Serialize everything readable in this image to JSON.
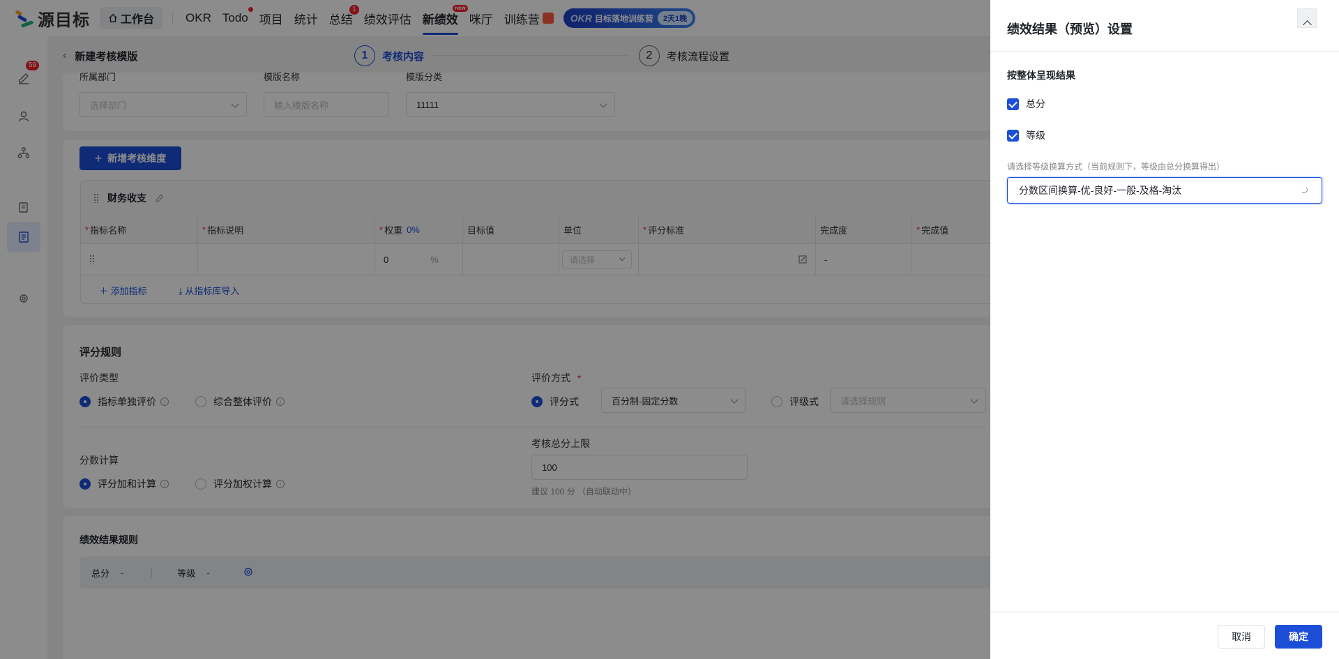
{
  "app": {
    "logo_text": "源目标"
  },
  "nav": {
    "workbench": "工作台",
    "items": [
      {
        "label": "OKR"
      },
      {
        "label": "Todo",
        "dot": true
      },
      {
        "label": "项目"
      },
      {
        "label": "统计"
      },
      {
        "label": "总结",
        "badge": "1"
      },
      {
        "label": "绩效评估"
      },
      {
        "label": "新绩效",
        "active": true,
        "badge_new": "new"
      },
      {
        "label": "咪厅"
      },
      {
        "label": "训练营"
      }
    ],
    "banner": {
      "okr": "OKR",
      "text": "目标落地训练营",
      "pill": "2天1晚"
    }
  },
  "sidebar": {
    "badge": "59"
  },
  "page": {
    "title": "新建考核模版",
    "steps": [
      {
        "num": "1",
        "label": "考核内容"
      },
      {
        "num": "2",
        "label": "考核流程设置"
      }
    ]
  },
  "basic": {
    "dept_label": "所属部门",
    "dept_placeholder": "选择部门",
    "name_label": "模版名称",
    "name_placeholder": "输入模版名称",
    "cat_label": "模版分类",
    "cat_value": "11111"
  },
  "dimension": {
    "add_button": "新增考核维度",
    "name": "财务收支",
    "columns": [
      "指标名称",
      "指标说明",
      "权重",
      "目标值",
      "单位",
      "评分标准",
      "完成度",
      "完成值"
    ],
    "weight_pct": "0%",
    "row": {
      "weight": "0",
      "unit_symbol": "%",
      "unit_placeholder": "请选择",
      "completion": "-"
    },
    "add_indicator": "添加指标",
    "import": "从指标库导入"
  },
  "scoring": {
    "title": "评分规则",
    "type_label": "评价类型",
    "type_options": [
      "指标单独评价",
      "综合整体评价"
    ],
    "method_label": "评价方式",
    "method_score": "评分式",
    "method_score_value": "百分制-固定分数",
    "method_level": "评级式",
    "method_level_placeholder": "请选择规则",
    "calc_label": "分数计算",
    "calc_options": [
      "评分加和计算",
      "评分加权计算"
    ],
    "limit_label": "考核总分上限",
    "limit_value": "100",
    "limit_hint": "建议 100 分 （自动联动中）"
  },
  "result": {
    "title": "绩效结果规则",
    "total_label": "总分",
    "total_value": "-",
    "level_label": "等级",
    "level_value": "-"
  },
  "drawer": {
    "title": "绩效结果（预览）设置",
    "section": "按整体呈现结果",
    "check_total": "总分",
    "check_level": "等级",
    "method_hint": "请选择等级换算方式（当前规则下，等级由总分换算得出）",
    "method_value": "分数区间换算-优-良好-一般-及格-淘汰",
    "cancel": "取消",
    "confirm": "确定"
  }
}
